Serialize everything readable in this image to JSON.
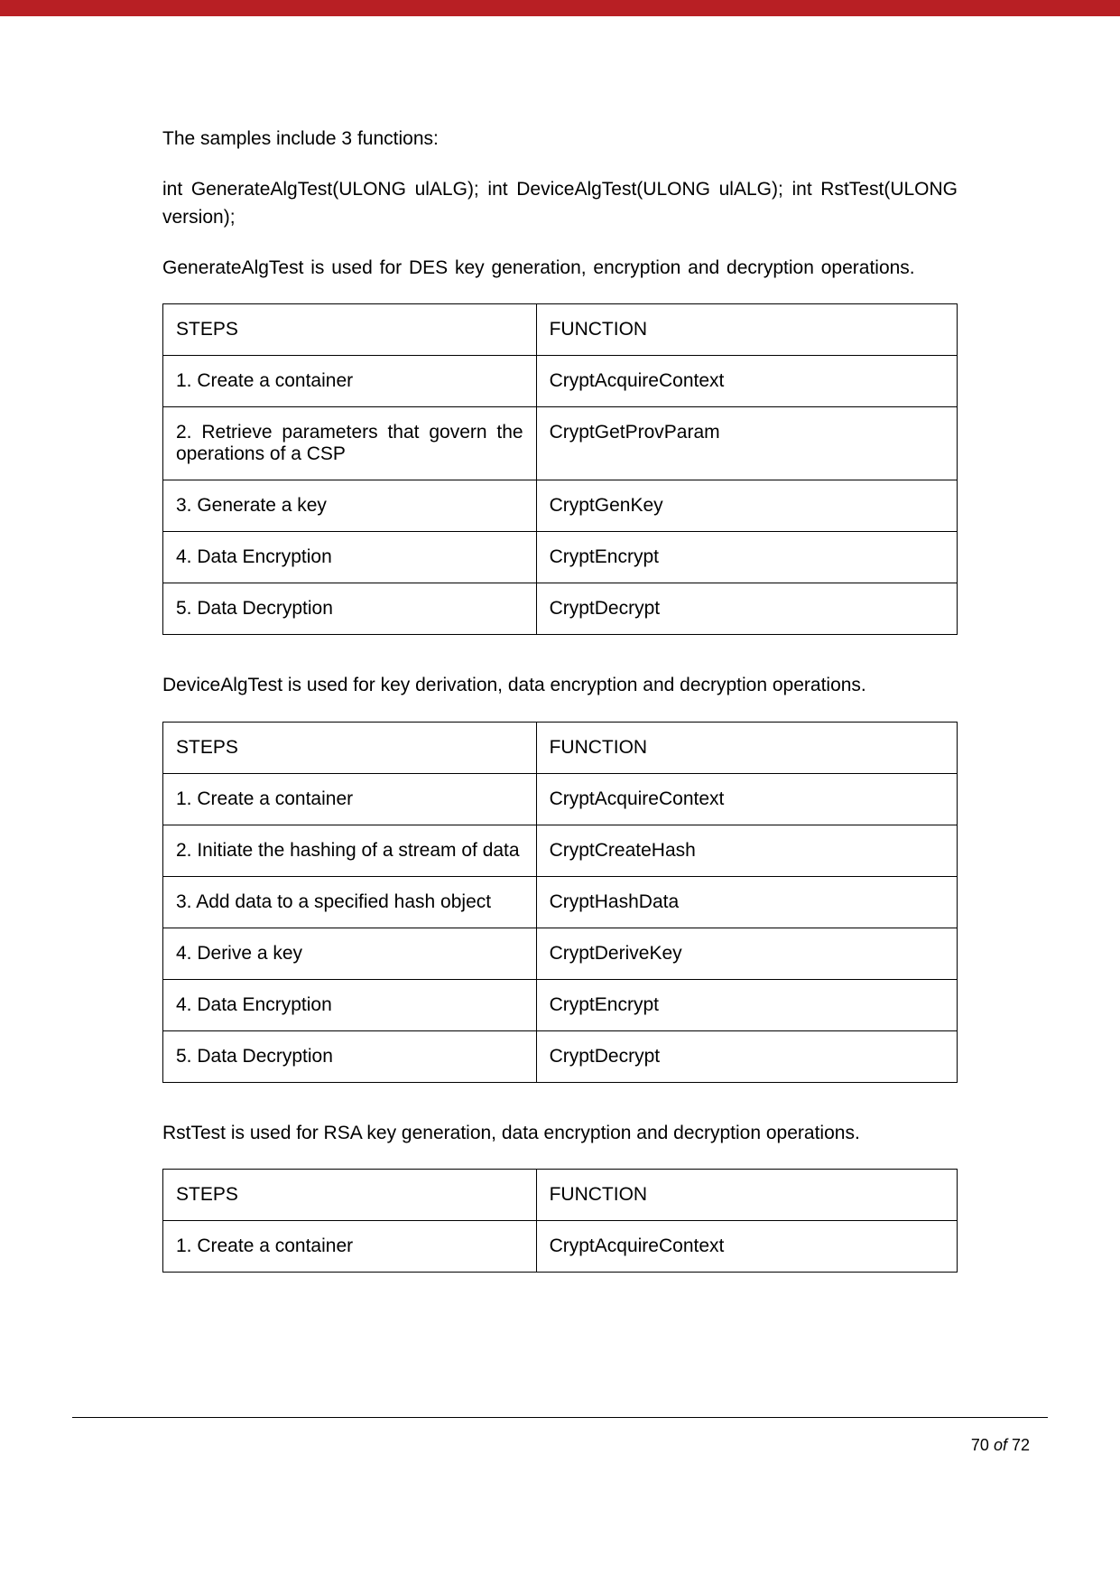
{
  "intro": {
    "p1": "The samples include 3 functions:",
    "p2": "int GenerateAlgTest(ULONG ulALG); int DeviceAlgTest(ULONG ulALG); int RstTest(ULONG version);",
    "p3": "GenerateAlgTest is used for DES key generation, encryption and decryption operations."
  },
  "table1": {
    "headers": {
      "steps": "STEPS",
      "function": "FUNCTION"
    },
    "rows": [
      {
        "step": "1. Create a container",
        "func": "CryptAcquireContext"
      },
      {
        "step": "2. Retrieve parameters that govern the operations of a CSP",
        "func": "CryptGetProvParam"
      },
      {
        "step": "3. Generate a key",
        "func": "CryptGenKey"
      },
      {
        "step": "4. Data Encryption",
        "func": "CryptEncrypt"
      },
      {
        "step": "5. Data Decryption",
        "func": "CryptDecrypt"
      }
    ]
  },
  "mid1": "DeviceAlgTest is used for key derivation, data encryption and decryption operations.",
  "table2": {
    "headers": {
      "steps": "STEPS",
      "function": "FUNCTION"
    },
    "rows": [
      {
        "step": "1. Create a container",
        "func": "CryptAcquireContext"
      },
      {
        "step": "2. Initiate the hashing of a stream of data",
        "func": "CryptCreateHash"
      },
      {
        "step": "3. Add data to a specified hash object",
        "func": "CryptHashData"
      },
      {
        "step": "4.  Derive a key",
        "func": "CryptDeriveKey"
      },
      {
        "step": "4. Data Encryption",
        "func": "CryptEncrypt"
      },
      {
        "step": "5. Data Decryption",
        "func": "CryptDecrypt"
      }
    ]
  },
  "mid2": "RstTest is used for RSA key generation, data encryption and decryption operations.",
  "table3": {
    "headers": {
      "steps": "STEPS",
      "function": "FUNCTION"
    },
    "rows": [
      {
        "step": "1. Create a container",
        "func": "CryptAcquireContext"
      }
    ]
  },
  "footer": {
    "page": "70",
    "of": "of",
    "total": "72"
  }
}
